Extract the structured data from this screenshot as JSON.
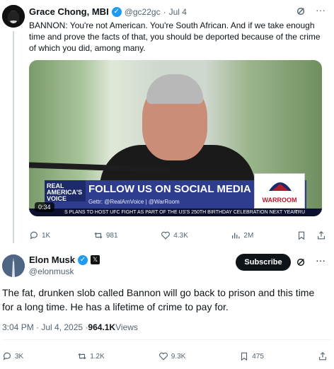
{
  "quoted": {
    "name": "Grace Chong, MBI",
    "handle": "@gc22gc",
    "separator": "·",
    "date": "Jul 4",
    "text": "BANNON: You're not American. You're South African. And if we take enough time and prove the facts of that, you should be deported because of the crime of which you did, among many.",
    "video": {
      "banner_left": "REAL AMERICA'S VOICE",
      "banner_main": "FOLLOW US ON SOCIAL MEDIA",
      "banner_sub": "Gettr: @RealAmVoice | @WarRoom",
      "logo_text": "WARROOM",
      "ticker": "S PLANS TO HOST UFC FIGHT AS PART OF THE US'S 250TH BIRTHDAY CELEBRATION NEXT YEAR",
      "ticker_tag": "TRU",
      "duration": "0:34"
    },
    "stats": {
      "replies": "1K",
      "reposts": "981",
      "likes": "4.3K",
      "views": "2M"
    }
  },
  "main": {
    "name": "Elon Musk",
    "handle": "@elonmusk",
    "subscribe_label": "Subscribe",
    "text": "The fat, drunken slob called Bannon will go back to prison and this time for a long time. He has a lifetime of crime to pay for.",
    "timestamp": "3:04 PM · Jul 4, 2025 · ",
    "views_count": "964.1K",
    "views_label": " Views",
    "stats": {
      "replies": "3K",
      "reposts": "1.2K",
      "likes": "9.3K",
      "bookmarks": "475"
    }
  },
  "colors": {
    "verified": "#1d9bf0",
    "text": "#0f1419",
    "muted": "#536471"
  }
}
